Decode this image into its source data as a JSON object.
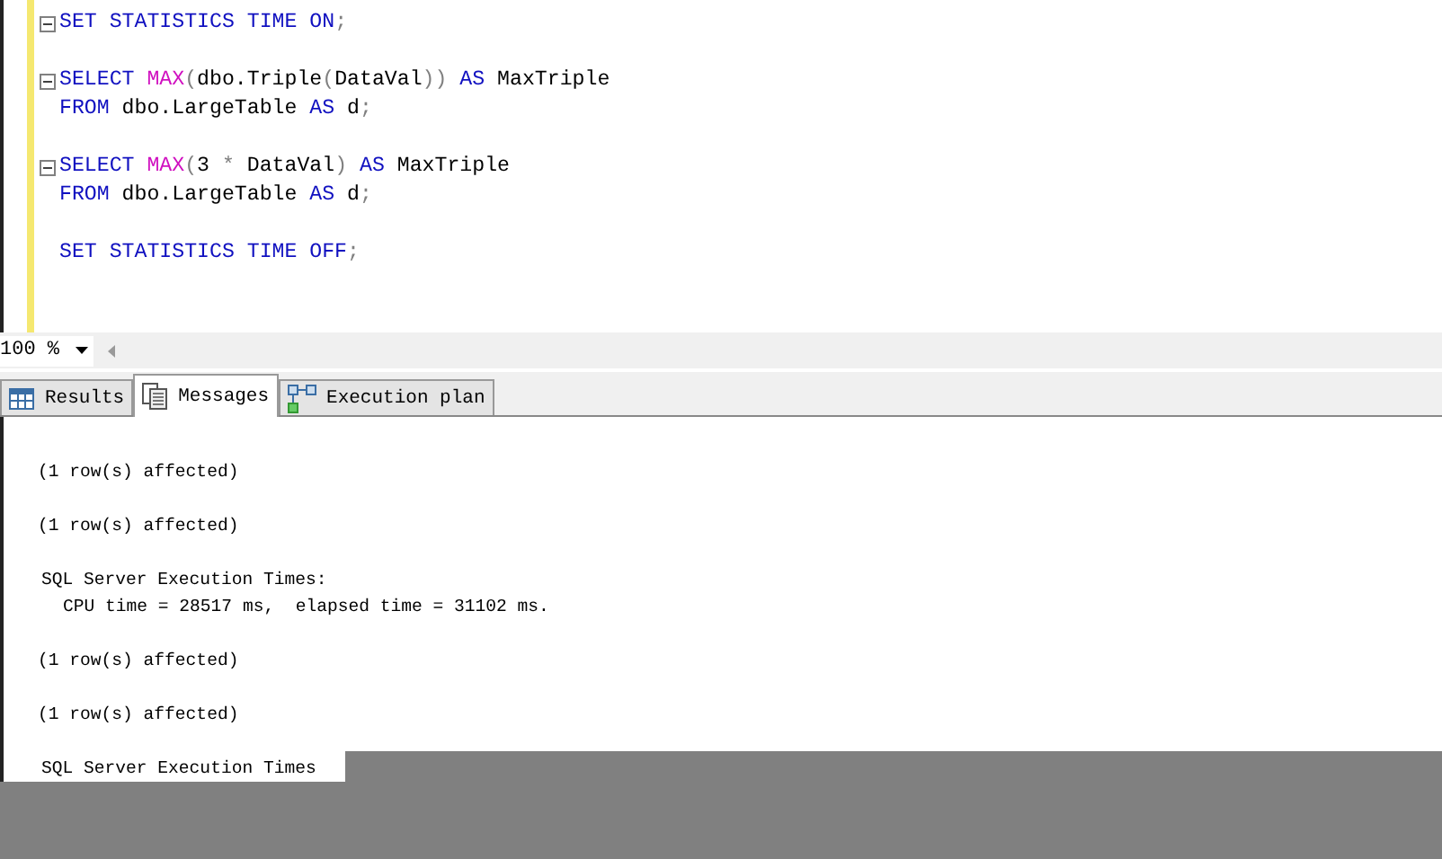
{
  "editor": {
    "blocks": [
      {
        "lines": [
          {
            "fold": true,
            "tokens": [
              {
                "text": "SET STATISTICS TIME ON",
                "kind": "keyword"
              },
              {
                "text": ";",
                "kind": "punct"
              }
            ]
          }
        ]
      },
      {
        "lines": [
          {
            "fold": true,
            "tokens": [
              {
                "text": "SELECT ",
                "kind": "keyword"
              },
              {
                "text": "MAX",
                "kind": "function"
              },
              {
                "text": "(",
                "kind": "punct"
              },
              {
                "text": "dbo.Triple",
                "kind": "plain"
              },
              {
                "text": "(",
                "kind": "punct"
              },
              {
                "text": "DataVal",
                "kind": "plain"
              },
              {
                "text": ")) ",
                "kind": "punct"
              },
              {
                "text": "AS ",
                "kind": "keyword"
              },
              {
                "text": "MaxTriple",
                "kind": "plain"
              }
            ]
          },
          {
            "fold": false,
            "tokens": [
              {
                "text": "FROM ",
                "kind": "keyword"
              },
              {
                "text": "dbo.LargeTable ",
                "kind": "plain"
              },
              {
                "text": "AS ",
                "kind": "keyword"
              },
              {
                "text": "d",
                "kind": "plain"
              },
              {
                "text": ";",
                "kind": "punct"
              }
            ]
          }
        ]
      },
      {
        "lines": [
          {
            "fold": true,
            "tokens": [
              {
                "text": "SELECT ",
                "kind": "keyword"
              },
              {
                "text": "MAX",
                "kind": "function"
              },
              {
                "text": "(",
                "kind": "punct"
              },
              {
                "text": "3 ",
                "kind": "plain"
              },
              {
                "text": "* ",
                "kind": "punct"
              },
              {
                "text": "DataVal",
                "kind": "plain"
              },
              {
                "text": ") ",
                "kind": "punct"
              },
              {
                "text": "AS ",
                "kind": "keyword"
              },
              {
                "text": "MaxTriple",
                "kind": "plain"
              }
            ]
          },
          {
            "fold": false,
            "tokens": [
              {
                "text": "FROM ",
                "kind": "keyword"
              },
              {
                "text": "dbo.LargeTable ",
                "kind": "plain"
              },
              {
                "text": "AS ",
                "kind": "keyword"
              },
              {
                "text": "d",
                "kind": "plain"
              },
              {
                "text": ";",
                "kind": "punct"
              }
            ]
          }
        ]
      },
      {
        "lines": [
          {
            "fold": false,
            "tokens": [
              {
                "text": "SET STATISTICS TIME OFF",
                "kind": "keyword"
              },
              {
                "text": ";",
                "kind": "punct"
              }
            ]
          }
        ]
      }
    ]
  },
  "zoom": {
    "value": "100 %"
  },
  "tabs": [
    {
      "label": "Results",
      "kind": "grid",
      "selected": false
    },
    {
      "label": "Messages",
      "kind": "document",
      "selected": true
    },
    {
      "label": "Execution plan",
      "kind": "plan",
      "selected": false
    }
  ],
  "messages": [
    {
      "lines": [
        {
          "text": "(1 row(s) affected)",
          "kind": "text"
        }
      ]
    },
    {
      "lines": [
        {
          "text": "(1 row(s) affected)",
          "kind": "text"
        }
      ]
    },
    {
      "lines": [
        {
          "text": "SQL Server Execution Times:",
          "kind": "heading"
        },
        {
          "text": "CPU time = 28517 ms,  elapsed time = 31102 ms.",
          "kind": "detail"
        }
      ]
    },
    {
      "lines": [
        {
          "text": "(1 row(s) affected)",
          "kind": "text"
        }
      ]
    },
    {
      "lines": [
        {
          "text": "(1 row(s) affected)",
          "kind": "text"
        }
      ]
    },
    {
      "lines": [
        {
          "text": "SQL Server Execution Times",
          "kind": "heading"
        }
      ]
    }
  ]
}
